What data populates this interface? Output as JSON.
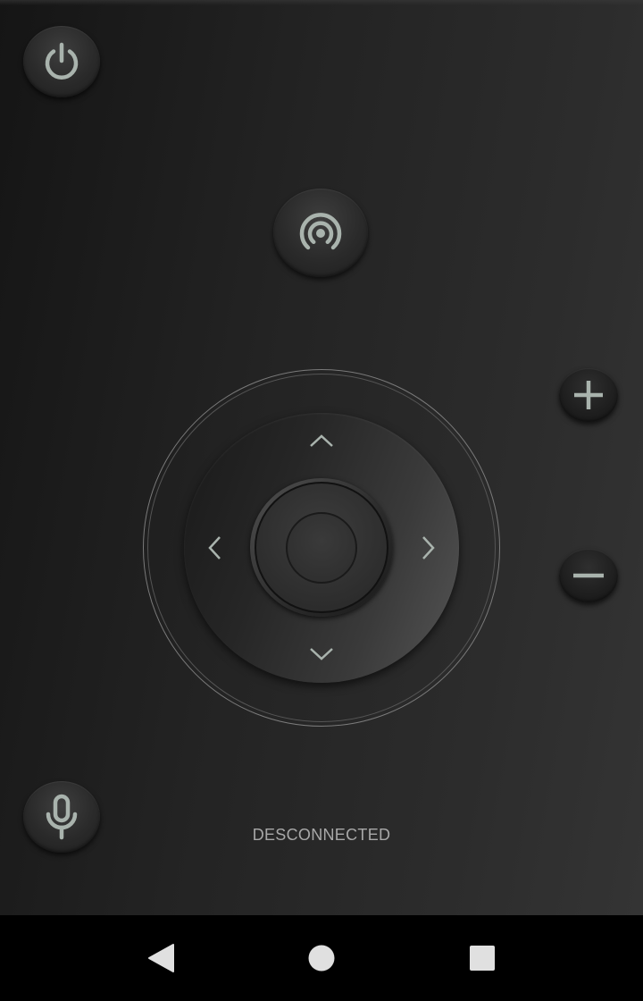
{
  "remote": {
    "status_text": "DESCONNECTED",
    "icon_color": "#a9b3ad",
    "buttons": {
      "power": "power-icon",
      "cast": "broadcast-icon",
      "mic": "microphone-icon",
      "volume_up": "plus-icon",
      "volume_down": "minus-icon"
    },
    "dpad": {
      "up": "chevron-up-icon",
      "down": "chevron-down-icon",
      "left": "chevron-left-icon",
      "right": "chevron-right-icon",
      "center": "ok-button"
    }
  },
  "navigation_bar": {
    "back": "back-triangle-icon",
    "home": "home-circle-icon",
    "recents": "recents-square-icon",
    "icon_color": "#e0e0e0"
  }
}
